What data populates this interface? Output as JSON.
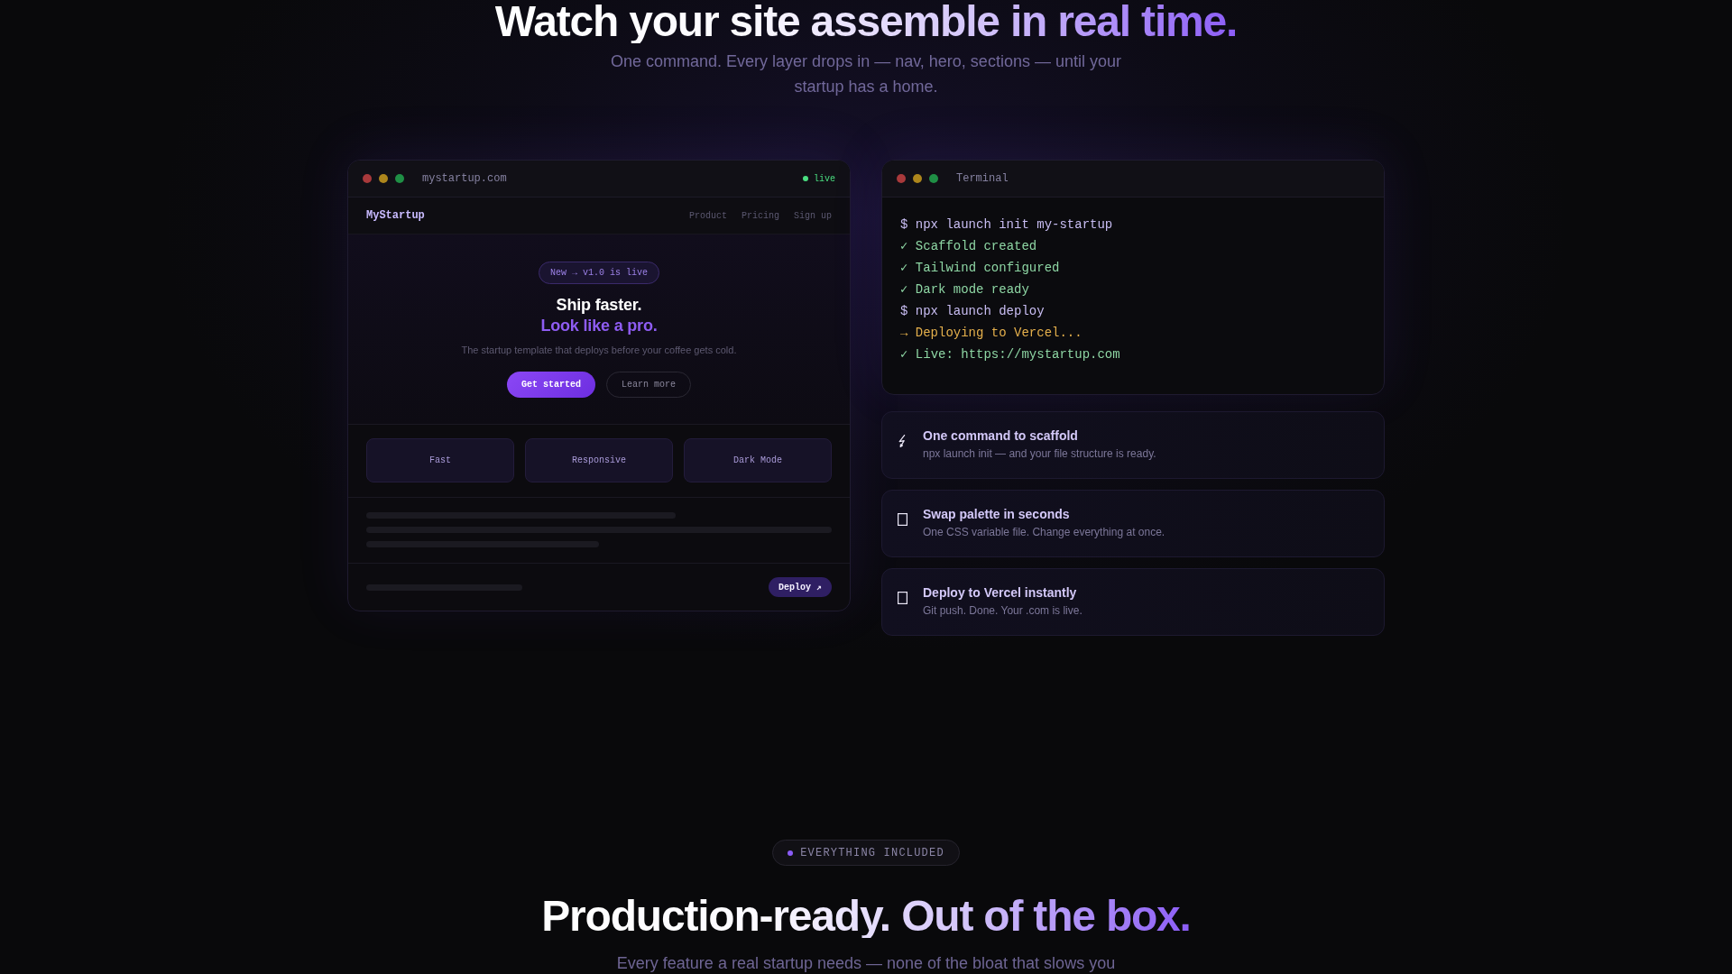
{
  "hero": {
    "title": "Watch your site assemble in real time.",
    "subtitle": "One command. Every layer drops in — nav, hero, sections — until your startup has a home."
  },
  "browser_preview": {
    "url": "mystartup.com",
    "status": "live",
    "site_nav": {
      "brand": "MyStartup",
      "links": [
        "Product",
        "Pricing",
        "Sign up"
      ]
    },
    "site_hero": {
      "badge": "New → v1.0 is live",
      "headline": "Ship faster.",
      "headline_accent": "Look like a pro.",
      "description": "The startup template that deploys before your coffee gets cold.",
      "primary_button": "Get started",
      "secondary_button": "Learn more"
    },
    "feature_tiles": [
      "Fast",
      "Responsive",
      "Dark Mode"
    ],
    "footer_button": "Deploy ↗"
  },
  "terminal": {
    "title": "Terminal",
    "lines": [
      {
        "kind": "command",
        "text": "$ npx launch init my-startup"
      },
      {
        "kind": "success",
        "text": "✓ Scaffold created"
      },
      {
        "kind": "success",
        "text": "✓ Tailwind configured"
      },
      {
        "kind": "success",
        "text": "✓ Dark mode ready"
      },
      {
        "kind": "command",
        "text": "$ npx launch deploy"
      },
      {
        "kind": "progress",
        "text": "→ Deploying to Vercel..."
      },
      {
        "kind": "success",
        "text": "✓ Live: https://mystartup.com"
      }
    ]
  },
  "features": [
    {
      "title": "One command to scaffold",
      "description": "npx launch init — and your file structure is ready."
    },
    {
      "title": "Swap palette in seconds",
      "description": "One CSS variable file. Change everything at once."
    },
    {
      "title": "Deploy to Vercel instantly",
      "description": "Git push. Done. Your .com is live."
    }
  ],
  "section": {
    "eyebrow": "EVERYTHING INCLUDED",
    "title": "Production-ready. Out of the box.",
    "subtitle": "Every feature a real startup needs — none of the bloat that slows you"
  }
}
